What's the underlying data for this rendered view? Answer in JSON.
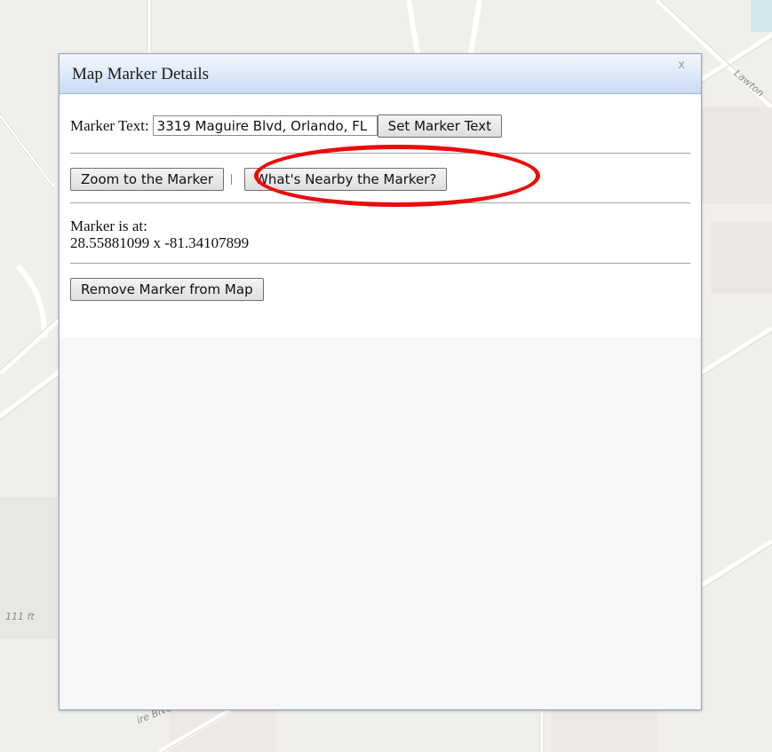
{
  "map": {
    "scale_label": "111 ft",
    "street_labels": [
      "Lawton",
      "ire Blvd"
    ]
  },
  "dialog": {
    "title": "Map Marker Details",
    "close_label": "x",
    "marker_text_label": "Marker Text:",
    "marker_text_value": "3319 Maguire Blvd, Orlando, FL",
    "set_marker_text_button": "Set Marker Text",
    "zoom_button": "Zoom to the Marker",
    "nearby_button": "What's Nearby the Marker?",
    "position_label": "Marker is at:",
    "position_value": "28.55881099 x -81.34107899",
    "remove_button": "Remove Marker from Map"
  },
  "colors": {
    "highlight": "#ec0b0b",
    "titlebar_top": "#f4f8fe",
    "titlebar_bottom": "#cadbf3",
    "map_background": "#f1efec"
  }
}
